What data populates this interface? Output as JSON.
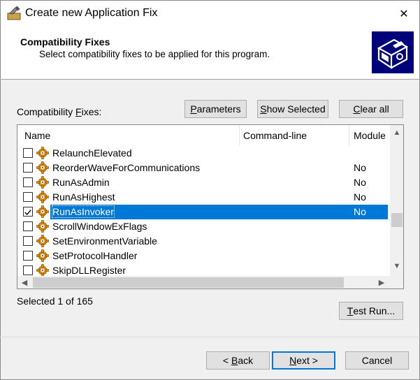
{
  "window": {
    "title": "Create new Application Fix",
    "close_glyph": "✕",
    "icon": "application-fix-wrench-icon"
  },
  "header": {
    "title": "Compatibility Fixes",
    "subtitle": "Select compatibility fixes to be applied for this program.",
    "graphic_icon": "app-fix-wizard-graphic"
  },
  "fixes": {
    "label_pre": "Compatibility ",
    "label_accel": "F",
    "label_post": "ixes:",
    "parameters_button": {
      "accel": "P",
      "rest": "arameters"
    },
    "show_selected_button": {
      "accel": "S",
      "rest": "how Selected"
    },
    "clear_all_button": {
      "accel": "C",
      "rest": "lear all"
    },
    "columns": [
      "Name",
      "Command-line",
      "Module"
    ],
    "rows": [
      {
        "name": "RelaunchElevated",
        "module": "",
        "checked": false,
        "selected": false
      },
      {
        "name": "ReorderWaveForCommunications",
        "module": "No",
        "checked": false,
        "selected": false
      },
      {
        "name": "RunAsAdmin",
        "module": "No",
        "checked": false,
        "selected": false
      },
      {
        "name": "RunAsHighest",
        "module": "No",
        "checked": false,
        "selected": false
      },
      {
        "name": "RunAsInvoker",
        "module": "No",
        "checked": true,
        "selected": true
      },
      {
        "name": "ScrollWindowExFlags",
        "module": "",
        "checked": false,
        "selected": false
      },
      {
        "name": "SetEnvironmentVariable",
        "module": "",
        "checked": false,
        "selected": false
      },
      {
        "name": "SetProtocolHandler",
        "module": "",
        "checked": false,
        "selected": false
      },
      {
        "name": "SkipDLLRegister",
        "module": "",
        "checked": false,
        "selected": false
      }
    ],
    "selected_count": "Selected 1 of 165",
    "test_run_button": {
      "accel": "T",
      "rest": "est Run..."
    }
  },
  "footer": {
    "back_button": {
      "pre": "< ",
      "accel": "B",
      "rest": "ack"
    },
    "next_button": {
      "accel": "N",
      "rest": "ext >"
    },
    "cancel_button": "Cancel"
  },
  "colors": {
    "selection": "#0078d7",
    "header_graphic_bg": "#00007a",
    "gear_icon": "#e08a00"
  }
}
